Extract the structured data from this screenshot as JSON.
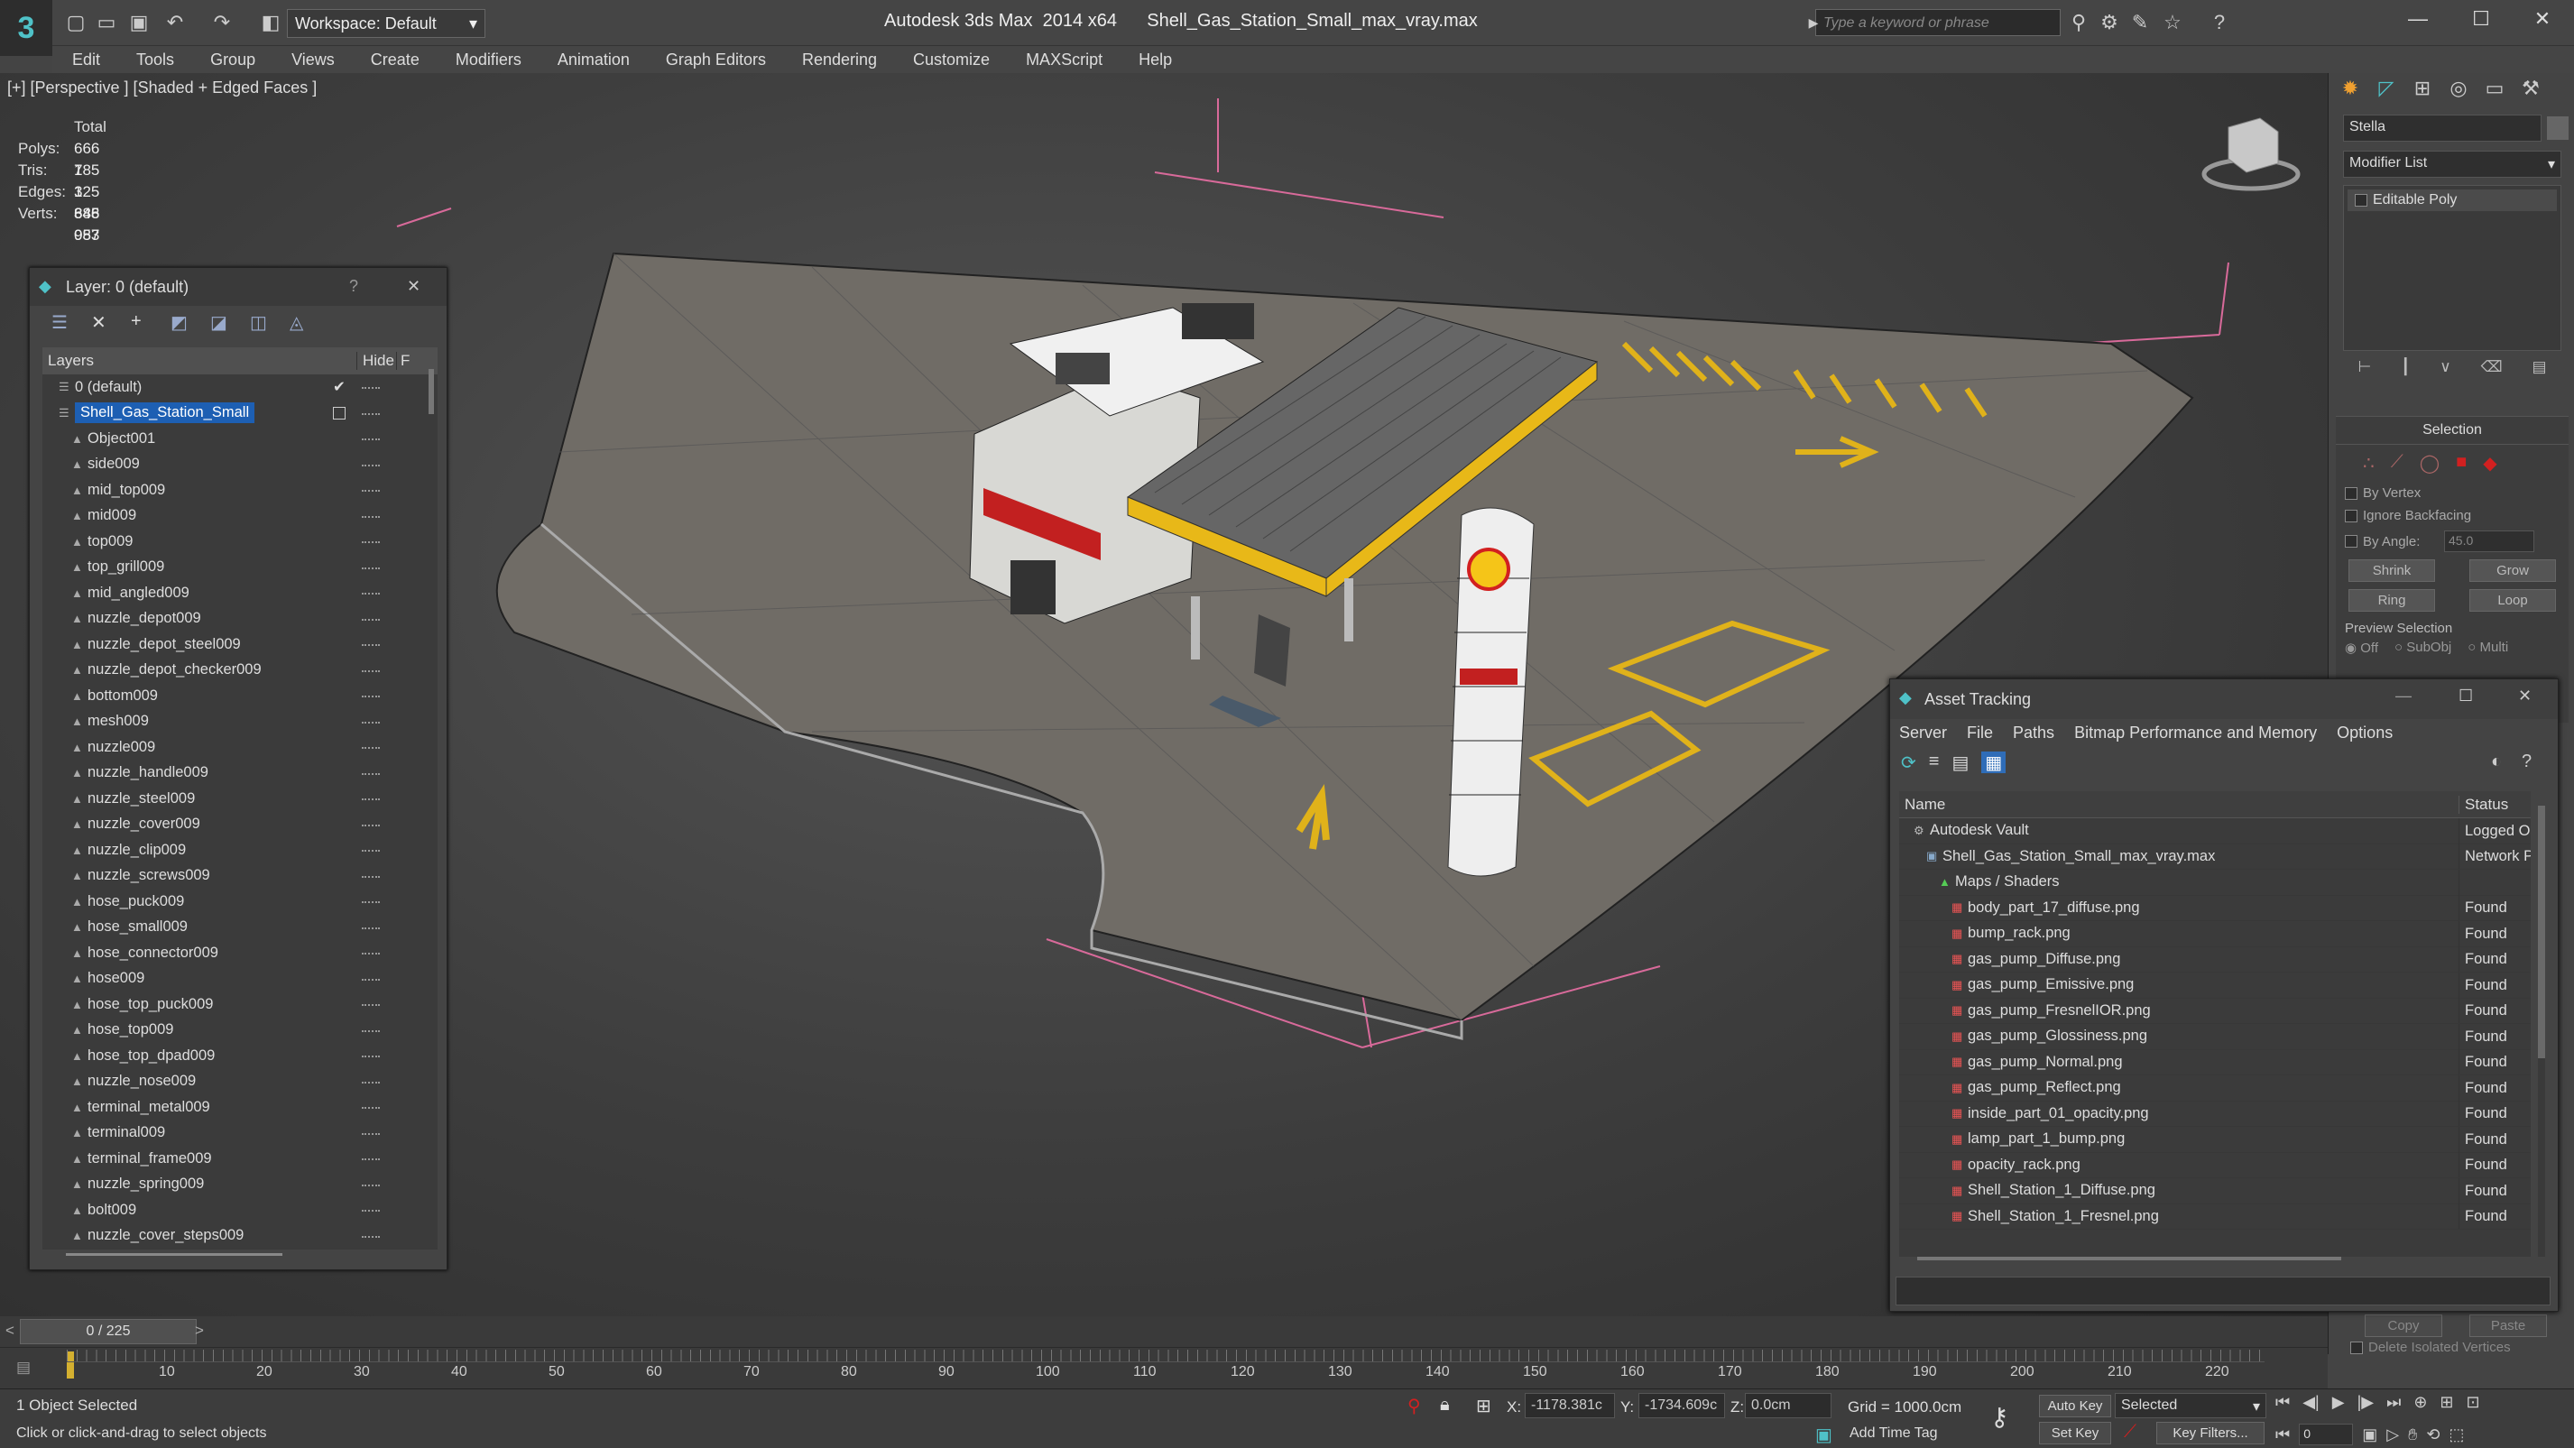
{
  "titlebar": {
    "app": "Autodesk 3ds Max  2014 x64",
    "file": "Shell_Gas_Station_Small_max_vray.max",
    "workspace": "Workspace: Default",
    "search_placeholder": "Type a keyword or phrase"
  },
  "menu": [
    "Edit",
    "Tools",
    "Group",
    "Views",
    "Create",
    "Modifiers",
    "Animation",
    "Graph Editors",
    "Rendering",
    "Customize",
    "MAXScript",
    "Help"
  ],
  "viewport": {
    "label": "[+] [Perspective ] [Shaded + Edged Faces ]",
    "stats": {
      "header": "Total",
      "rows": [
        {
          "k": "Polys:",
          "v": "666 785"
        },
        {
          "k": "Tris:",
          "v": "1 325 846"
        },
        {
          "k": "Edges:",
          "v": "1 348 987"
        },
        {
          "k": "Verts:",
          "v": "685 053"
        }
      ]
    }
  },
  "layer_panel": {
    "title": "Layer: 0 (default)",
    "help": "?",
    "close": "✕",
    "col_layers": "Layers",
    "col_hide": "Hide",
    "col_f": "F",
    "rows": [
      "0 (default)",
      "Shell_Gas_Station_Small",
      "Object001",
      "side009",
      "mid_top009",
      "mid009",
      "top009",
      "top_grill009",
      "mid_angled009",
      "nuzzle_depot009",
      "nuzzle_depot_steel009",
      "nuzzle_depot_checker009",
      "bottom009",
      "mesh009",
      "nuzzle009",
      "nuzzle_handle009",
      "nuzzle_steel009",
      "nuzzle_cover009",
      "nuzzle_clip009",
      "nuzzle_screws009",
      "hose_puck009",
      "hose_small009",
      "hose_connector009",
      "hose009",
      "hose_top_puck009",
      "hose_top009",
      "hose_top_dpad009",
      "nuzzle_nose009",
      "terminal_metal009",
      "terminal009",
      "terminal_frame009",
      "nuzzle_spring009",
      "bolt009",
      "nuzzle_cover_steps009"
    ]
  },
  "cmd_panel": {
    "object_name": "Stella",
    "modifier_list": "Modifier List",
    "stack_item": "Editable Poly",
    "selection_title": "Selection",
    "by_vertex": "By Vertex",
    "ignore_backfacing": "Ignore Backfacing",
    "by_angle": "By Angle:",
    "angle_value": "45.0",
    "shrink": "Shrink",
    "grow": "Grow",
    "ring": "Ring",
    "loop": "Loop",
    "preview_title": "Preview Selection",
    "preview_off": "Off",
    "preview_subobj": "SubObj",
    "preview_multi": "Multi",
    "copy": "Copy",
    "paste": "Paste",
    "delete_isolated": "Delete Isolated Vertices"
  },
  "asset": {
    "title": "Asset Tracking",
    "menu": [
      "Server",
      "File",
      "Paths",
      "Bitmap Performance and Memory",
      "Options"
    ],
    "col_name": "Name",
    "col_status": "Status",
    "rows": [
      {
        "n": "Autodesk Vault",
        "s": "Logged Ou",
        "lvl": 1
      },
      {
        "n": "Shell_Gas_Station_Small_max_vray.max",
        "s": "Network P",
        "lvl": 2
      },
      {
        "n": "Maps / Shaders",
        "s": "",
        "lvl": 3
      },
      {
        "n": "body_part_17_diffuse.png",
        "s": "Found",
        "lvl": 4
      },
      {
        "n": "bump_rack.png",
        "s": "Found",
        "lvl": 4
      },
      {
        "n": "gas_pump_Diffuse.png",
        "s": "Found",
        "lvl": 4
      },
      {
        "n": "gas_pump_Emissive.png",
        "s": "Found",
        "lvl": 4
      },
      {
        "n": "gas_pump_FresnelIOR.png",
        "s": "Found",
        "lvl": 4
      },
      {
        "n": "gas_pump_Glossiness.png",
        "s": "Found",
        "lvl": 4
      },
      {
        "n": "gas_pump_Normal.png",
        "s": "Found",
        "lvl": 4
      },
      {
        "n": "gas_pump_Reflect.png",
        "s": "Found",
        "lvl": 4
      },
      {
        "n": "inside_part_01_opacity.png",
        "s": "Found",
        "lvl": 4
      },
      {
        "n": "lamp_part_1_bump.png",
        "s": "Found",
        "lvl": 4
      },
      {
        "n": "opacity_rack.png",
        "s": "Found",
        "lvl": 4
      },
      {
        "n": "Shell_Station_1_Diffuse.png",
        "s": "Found",
        "lvl": 4
      },
      {
        "n": "Shell_Station_1_Fresnel.png",
        "s": "Found",
        "lvl": 4
      }
    ]
  },
  "timeline": {
    "frame": "0 / 225",
    "ticks": [
      "10",
      "20",
      "30",
      "40",
      "50",
      "60",
      "70",
      "80",
      "90",
      "100",
      "110",
      "120",
      "130",
      "140",
      "150",
      "160",
      "170",
      "180",
      "190",
      "200",
      "210",
      "220"
    ]
  },
  "status": {
    "selected": "1 Object Selected",
    "hint": "Click or click-and-drag to select objects",
    "x_label": "X:",
    "x": "-1178.381c",
    "y_label": "Y:",
    "y": "-1734.609c",
    "z_label": "Z:",
    "z": "0.0cm",
    "grid": "Grid = 1000.0cm",
    "add_time_tag": "Add Time Tag",
    "auto_key": "Auto Key",
    "set_key": "Set Key",
    "key_mode": "Selected",
    "key_filters": "Key Filters...",
    "frame_field": "0"
  },
  "colors": {
    "accent": "#1d5fb3",
    "shell_yellow": "#f5c518",
    "shell_red": "#d22020"
  }
}
